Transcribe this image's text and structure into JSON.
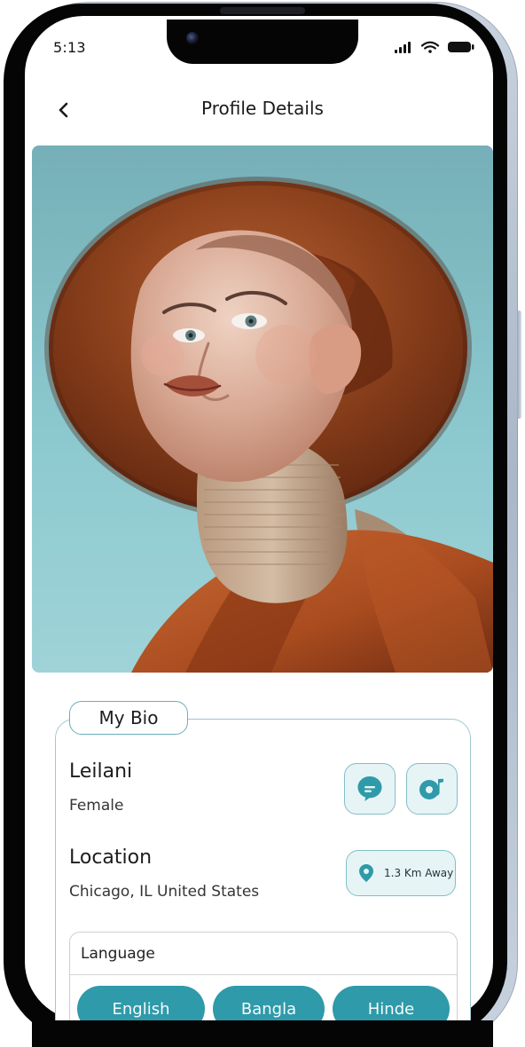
{
  "status_bar": {
    "time": "5:13"
  },
  "header": {
    "title": "Profile Details",
    "back_icon": "chevron-left-icon"
  },
  "profile": {
    "bio_label": "My Bio",
    "name": "Leilani",
    "gender": "Female",
    "location_label": "Location",
    "location_value": "Chicago, IL United States",
    "distance_label": "1.3 Km Away"
  },
  "actions": {
    "chat_icon": "chat-bubble-icon",
    "music_icon": "music-disc-icon",
    "location_icon": "location-pin-icon"
  },
  "languages": {
    "title": "Language",
    "items": [
      {
        "label": "English"
      },
      {
        "label": "Bangla"
      },
      {
        "label": "Hinde"
      }
    ]
  },
  "colors": {
    "accent": "#2f9aa9",
    "accent_light": "#e6f4f6",
    "accent_border": "#84bec6",
    "text_primary": "#1c1c1c"
  }
}
